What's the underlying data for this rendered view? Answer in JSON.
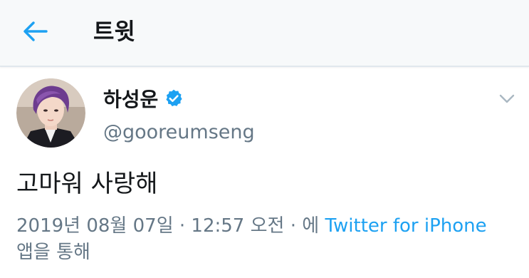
{
  "header": {
    "back_icon": "arrow-left-icon",
    "title": "트윗"
  },
  "tweet": {
    "author": {
      "display_name": "하성운",
      "verified": true,
      "username": "@gooreumseng"
    },
    "text": "고마워 사랑해",
    "timestamp": "2019년 08월 07일 · 12:57 오전 · 에",
    "source_link": "Twitter for iPhone",
    "source_suffix": "앱을 통해"
  },
  "colors": {
    "accent": "#1da1f2",
    "secondary_text": "#657786",
    "primary_text": "#14171a",
    "header_bg": "#f7f9fa"
  },
  "icons": {
    "verified": "verified-badge-icon",
    "caret": "chevron-down-icon"
  }
}
